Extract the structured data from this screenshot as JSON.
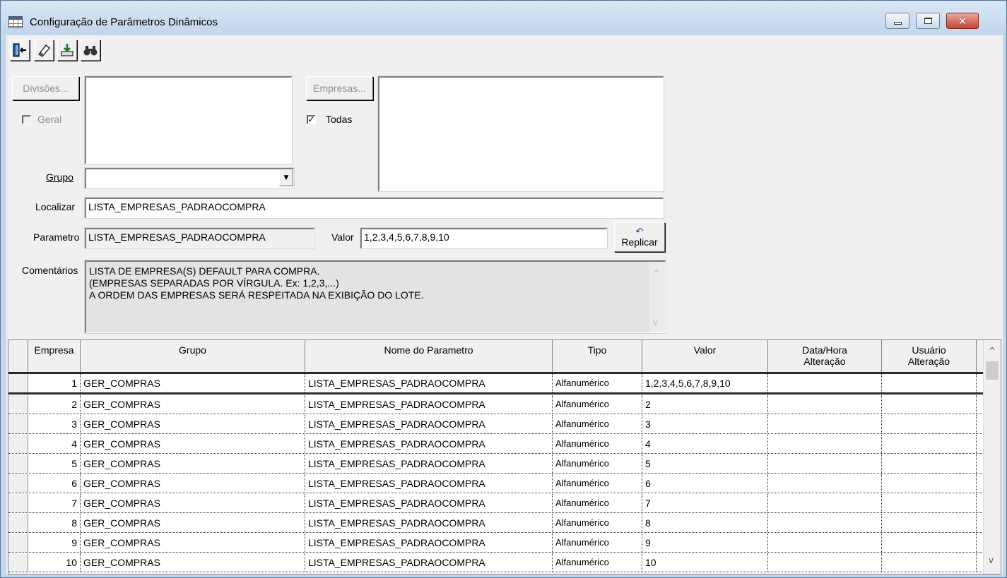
{
  "window": {
    "title": "Configuração de Parâmetros Dinâmicos",
    "buttons": {
      "minimize": "minimize-icon",
      "maximize": "maximize-icon",
      "close": "close-icon"
    }
  },
  "toolbar": {
    "icons": [
      "exit-door-icon",
      "eraser-icon",
      "download-tray-icon",
      "binoculars-icon"
    ]
  },
  "filters": {
    "divisoes_label": "Divisões...",
    "geral_label": "Geral",
    "geral_checked": false,
    "empresas_label": "Empresas...",
    "todas_label": "Todas",
    "todas_checked": true,
    "grupo_label": "Grupo",
    "grupo_value": ""
  },
  "search": {
    "localizar_label": "Localizar",
    "localizar_value": "LISTA_EMPRESAS_PADRAOCOMPRA"
  },
  "editor": {
    "parametro_label": "Parametro",
    "parametro_value": "LISTA_EMPRESAS_PADRAOCOMPRA",
    "valor_label": "Valor",
    "valor_value": "1,2,3,4,5,6,7,8,9,10",
    "replicar_label": "Replicar",
    "comentarios_label": "Comentários",
    "comentarios_lines": [
      "LISTA DE EMPRESA(S) DEFAULT PARA COMPRA.",
      "(EMPRESAS SEPARADAS POR VÍRGULA. Ex: 1,2,3,...)",
      "A ORDEM DAS EMPRESAS SERÁ RESPEITADA NA EXIBIÇÃO DO LOTE."
    ]
  },
  "grid": {
    "headers": {
      "empresa": "Empresa",
      "grupo": "Grupo",
      "nome": "Nome do Parametro",
      "tipo": "Tipo",
      "valor": "Valor",
      "data_hora_1": "Data/Hora",
      "data_hora_2": "Alteração",
      "usuario_1": "Usuário",
      "usuario_2": "Alteração"
    },
    "rows": [
      {
        "empresa": "1",
        "grupo": "GER_COMPRAS",
        "nome": "LISTA_EMPRESAS_PADRAOCOMPRA",
        "tipo": "Alfanumérico",
        "valor": "1,2,3,4,5,6,7,8,9,10",
        "data_hora": "",
        "usuario": ""
      },
      {
        "empresa": "2",
        "grupo": "GER_COMPRAS",
        "nome": "LISTA_EMPRESAS_PADRAOCOMPRA",
        "tipo": "Alfanumérico",
        "valor": "2",
        "data_hora": "",
        "usuario": ""
      },
      {
        "empresa": "3",
        "grupo": "GER_COMPRAS",
        "nome": "LISTA_EMPRESAS_PADRAOCOMPRA",
        "tipo": "Alfanumérico",
        "valor": "3",
        "data_hora": "",
        "usuario": ""
      },
      {
        "empresa": "4",
        "grupo": "GER_COMPRAS",
        "nome": "LISTA_EMPRESAS_PADRAOCOMPRA",
        "tipo": "Alfanumérico",
        "valor": "4",
        "data_hora": "",
        "usuario": ""
      },
      {
        "empresa": "5",
        "grupo": "GER_COMPRAS",
        "nome": "LISTA_EMPRESAS_PADRAOCOMPRA",
        "tipo": "Alfanumérico",
        "valor": "5",
        "data_hora": "",
        "usuario": ""
      },
      {
        "empresa": "6",
        "grupo": "GER_COMPRAS",
        "nome": "LISTA_EMPRESAS_PADRAOCOMPRA",
        "tipo": "Alfanumérico",
        "valor": "6",
        "data_hora": "",
        "usuario": ""
      },
      {
        "empresa": "7",
        "grupo": "GER_COMPRAS",
        "nome": "LISTA_EMPRESAS_PADRAOCOMPRA",
        "tipo": "Alfanumérico",
        "valor": "7",
        "data_hora": "",
        "usuario": ""
      },
      {
        "empresa": "8",
        "grupo": "GER_COMPRAS",
        "nome": "LISTA_EMPRESAS_PADRAOCOMPRA",
        "tipo": "Alfanumérico",
        "valor": "8",
        "data_hora": "",
        "usuario": ""
      },
      {
        "empresa": "9",
        "grupo": "GER_COMPRAS",
        "nome": "LISTA_EMPRESAS_PADRAOCOMPRA",
        "tipo": "Alfanumérico",
        "valor": "9",
        "data_hora": "",
        "usuario": ""
      },
      {
        "empresa": "10",
        "grupo": "GER_COMPRAS",
        "nome": "LISTA_EMPRESAS_PADRAOCOMPRA",
        "tipo": "Alfanumérico",
        "valor": "10",
        "data_hora": "",
        "usuario": ""
      }
    ]
  }
}
